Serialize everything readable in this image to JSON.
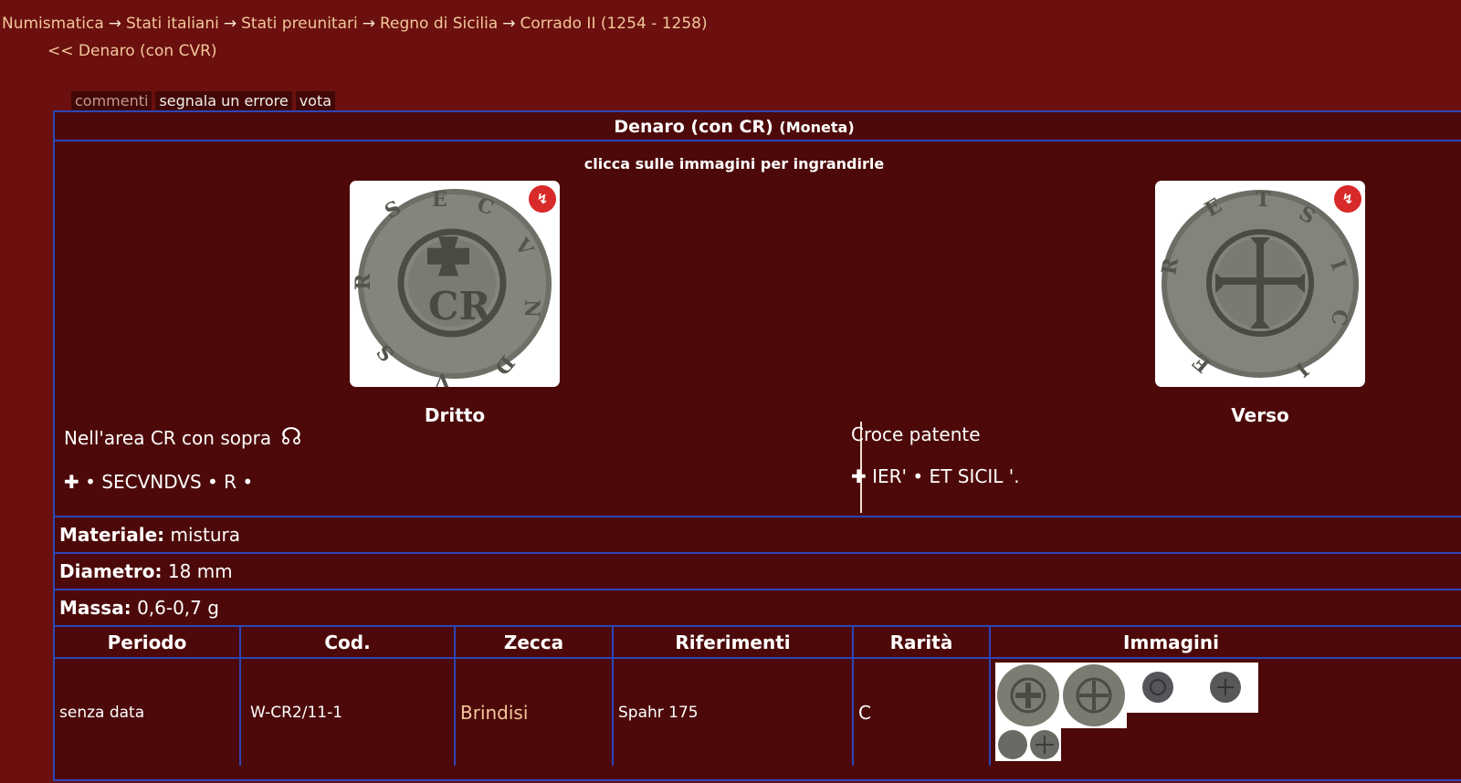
{
  "breadcrumb": {
    "items": [
      "Numismatica",
      "Stati italiani",
      "Stati preunitari",
      "Regno di Sicilia",
      "Corrado II (1254 - 1258)"
    ],
    "separator": "→"
  },
  "back_link": "<< Denaro (con CVR)",
  "tabs": [
    {
      "label": "commenti"
    },
    {
      "label": "segnala un errore"
    },
    {
      "label": "vota"
    }
  ],
  "coin": {
    "title": "Denaro (con CR)",
    "type": "(Moneta)",
    "hint": "clicca sulle immagini per ingrandirle",
    "obverse": {
      "label": "Dritto",
      "description": "Nell'area CR con sopra",
      "symbol": "☊",
      "legend": "✚ • SECVNDVS • R •"
    },
    "reverse": {
      "label": "Verso",
      "description": "Croce patente",
      "legend": "✚ IER' • ET SICIL '."
    },
    "badge_icon": "red-circle-logo-icon",
    "properties": {
      "material_label": "Materiale:",
      "material": "mistura",
      "diameter_label": "Diametro:",
      "diameter": "18 mm",
      "mass_label": "Massa:",
      "mass": "0,6-0,7 g"
    }
  },
  "table": {
    "headers": [
      "Periodo",
      "Cod.",
      "Zecca",
      "Riferimenti",
      "Rarità",
      "Immagini"
    ],
    "rows": [
      {
        "periodo": "senza data",
        "cod": "W-CR2/11-1",
        "zecca": "Brindisi",
        "riferimenti": "Spahr 175",
        "rarita": "C"
      }
    ]
  },
  "colors": {
    "page_bg": "#6b100e",
    "panel_bg": "#4d0909",
    "border": "#2c46b8",
    "link": "#f2c79a"
  }
}
